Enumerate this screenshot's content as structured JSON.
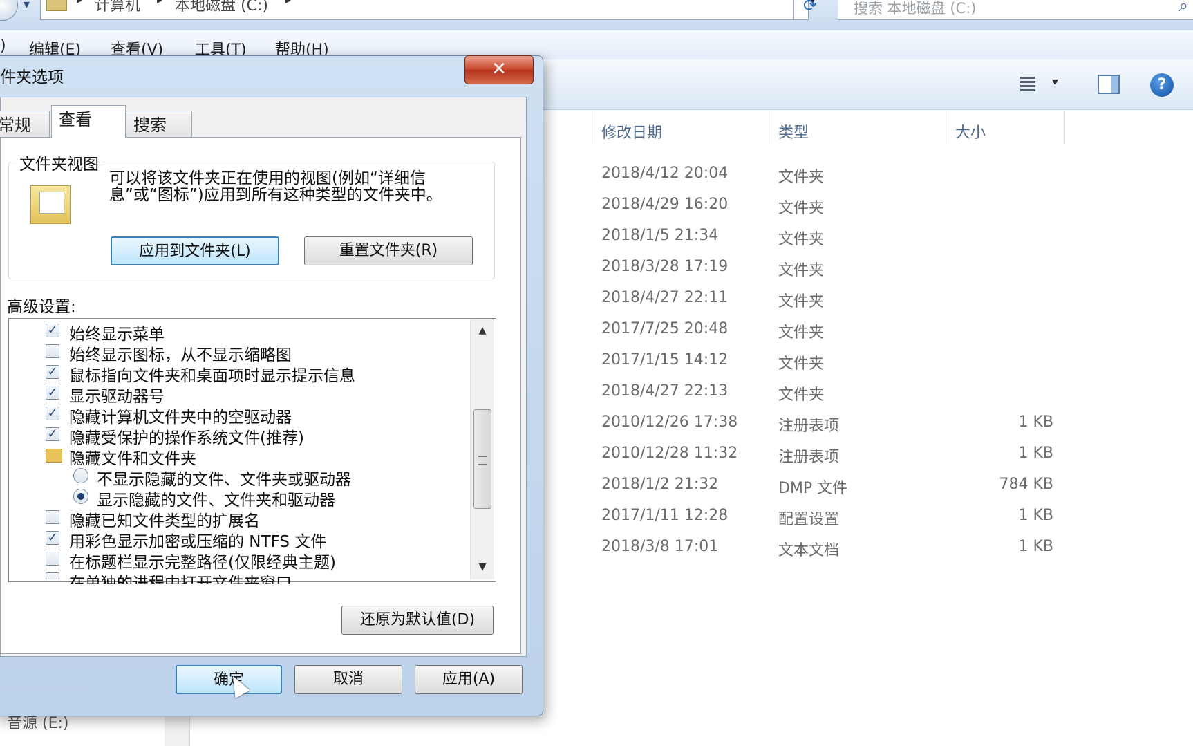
{
  "explorer": {
    "breadcrumb": [
      "计算机",
      "本地磁盘 (C:)"
    ],
    "search_placeholder": "搜索 本地磁盘 (C:)",
    "menu": [
      "编辑(E)",
      "查看(V)",
      "工具(T)",
      "帮助(H)"
    ],
    "menu_left_fragment": ")",
    "columns": [
      "修改日期",
      "类型",
      "大小"
    ],
    "rows": [
      {
        "date": "2018/4/12 20:04",
        "type": "文件夹",
        "size": ""
      },
      {
        "date": "2018/4/29 16:20",
        "type": "文件夹",
        "size": ""
      },
      {
        "date": "2018/1/5 21:34",
        "type": "文件夹",
        "size": ""
      },
      {
        "date": "2018/3/28 17:19",
        "type": "文件夹",
        "size": ""
      },
      {
        "date": "2018/4/27 22:11",
        "type": "文件夹",
        "size": ""
      },
      {
        "date": "2017/7/25 20:48",
        "type": "文件夹",
        "size": ""
      },
      {
        "date": "2017/1/15 14:12",
        "type": "文件夹",
        "size": ""
      },
      {
        "date": "2018/4/27 22:13",
        "type": "文件夹",
        "size": ""
      },
      {
        "date": "2010/12/26 17:38",
        "type": "注册表项",
        "size": "1 KB"
      },
      {
        "date": "2010/12/28 11:32",
        "type": "注册表项",
        "size": "1 KB"
      },
      {
        "date": "2018/1/2 21:32",
        "type": "DMP 文件",
        "size": "784 KB"
      },
      {
        "date": "2017/1/11 12:28",
        "type": "配置设置",
        "size": "1 KB"
      },
      {
        "date": "2018/3/8 17:01",
        "type": "文本文档",
        "size": "1 KB"
      }
    ],
    "nav_bottom_item": "音源 (E:)"
  },
  "dialog": {
    "title": "件夹选项",
    "close_label": "✕",
    "tabs": [
      "常规",
      "查看",
      "搜索"
    ],
    "active_tab": "查看",
    "folder_views": {
      "label": "文件夹视图",
      "description": "可以将该文件夹正在使用的视图(例如“详细信息”或“图标”)应用到所有这种类型的文件夹中。",
      "apply_button": "应用到文件夹(L)",
      "reset_button": "重置文件夹(R)"
    },
    "advanced_label": "高级设置:",
    "advanced_options": [
      {
        "label": "始终显示菜单",
        "kind": "checkbox",
        "checked": true
      },
      {
        "label": "始终显示图标，从不显示缩略图",
        "kind": "checkbox",
        "checked": false
      },
      {
        "label": "鼠标指向文件夹和桌面项时显示提示信息",
        "kind": "checkbox",
        "checked": true
      },
      {
        "label": "显示驱动器号",
        "kind": "checkbox",
        "checked": true
      },
      {
        "label": "隐藏计算机文件夹中的空驱动器",
        "kind": "checkbox",
        "checked": true
      },
      {
        "label": "隐藏受保护的操作系统文件(推荐)",
        "kind": "checkbox",
        "checked": true
      },
      {
        "label": "隐藏文件和文件夹",
        "kind": "folder",
        "checked": false
      },
      {
        "label": "不显示隐藏的文件、文件夹或驱动器",
        "kind": "radio",
        "checked": false
      },
      {
        "label": "显示隐藏的文件、文件夹和驱动器",
        "kind": "radio",
        "checked": true
      },
      {
        "label": "隐藏已知文件类型的扩展名",
        "kind": "checkbox",
        "checked": false
      },
      {
        "label": "用彩色显示加密或压缩的 NTFS 文件",
        "kind": "checkbox",
        "checked": true
      },
      {
        "label": "在标题栏显示完整路径(仅限经典主题)",
        "kind": "checkbox",
        "checked": false
      },
      {
        "label": "在单独的进程中打开文件夹窗口",
        "kind": "checkbox",
        "checked": false
      }
    ],
    "restore_button": "还原为默认值(D)",
    "ok_button": "确定",
    "cancel_button": "取消",
    "apply_button": "应用(A)"
  }
}
